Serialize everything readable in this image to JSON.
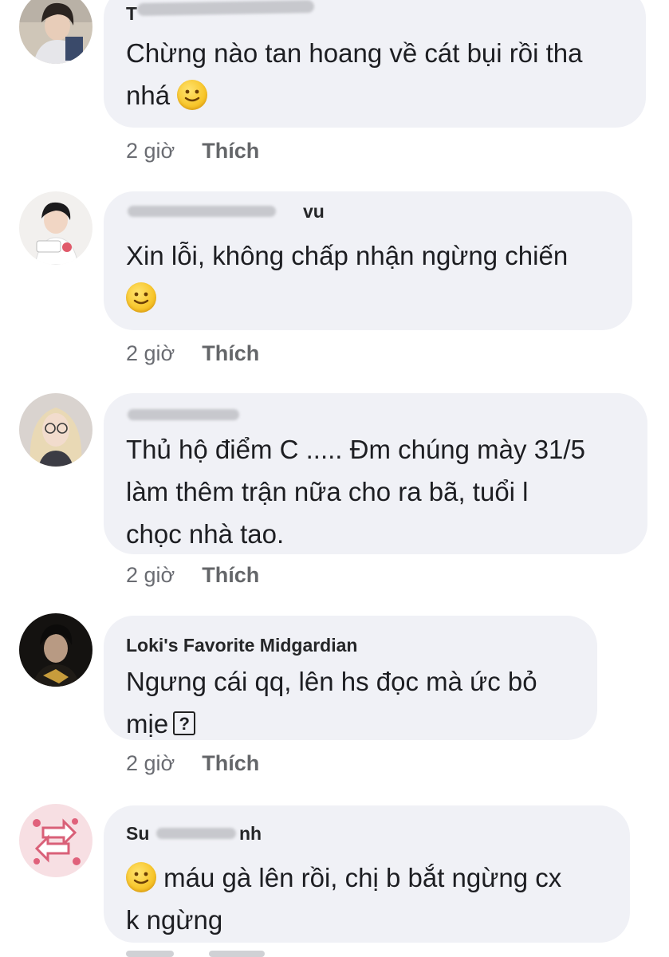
{
  "comments": [
    {
      "name_visible": "T",
      "text_lines": [
        "Chừng nào tan hoang về cát bụi rồi tha",
        "nhá"
      ],
      "emoji": "smiley-emoji",
      "time": "2 giờ",
      "like_label": "Thích"
    },
    {
      "name_visible": "vu",
      "text_lines": [
        "Xin lỗi, không chấp nhận ngừng chiến",
        ""
      ],
      "emoji": "smiley-emoji",
      "time": "2 giờ",
      "like_label": "Thích"
    },
    {
      "name_visible": "",
      "text_lines": [
        "Thủ hộ điểm C ..... Đm chúng mày 31/5",
        "làm thêm trận nữa cho ra bã, tuổi l",
        "chọc nhà tao."
      ],
      "time": "2 giờ",
      "like_label": "Thích"
    },
    {
      "name_visible": "Loki's Favorite Midgardian",
      "text_lines": [
        "Ngưng cái qq, lên hs đọc mà ức bỏ",
        "mịe"
      ],
      "unknown_glyph": "?",
      "time": "2 giờ",
      "like_label": "Thích"
    },
    {
      "name_visible_start": "Su",
      "name_visible_end": "nh",
      "text_lines": [
        "máu gà lên rồi, chị b bắt ngừng cx",
        "k ngừng"
      ],
      "emoji": "smiley-emoji"
    }
  ],
  "colors": {
    "bubble": "#f0f1f6",
    "meta_text": "#6a6c72",
    "emoji": "#f7c52a"
  }
}
